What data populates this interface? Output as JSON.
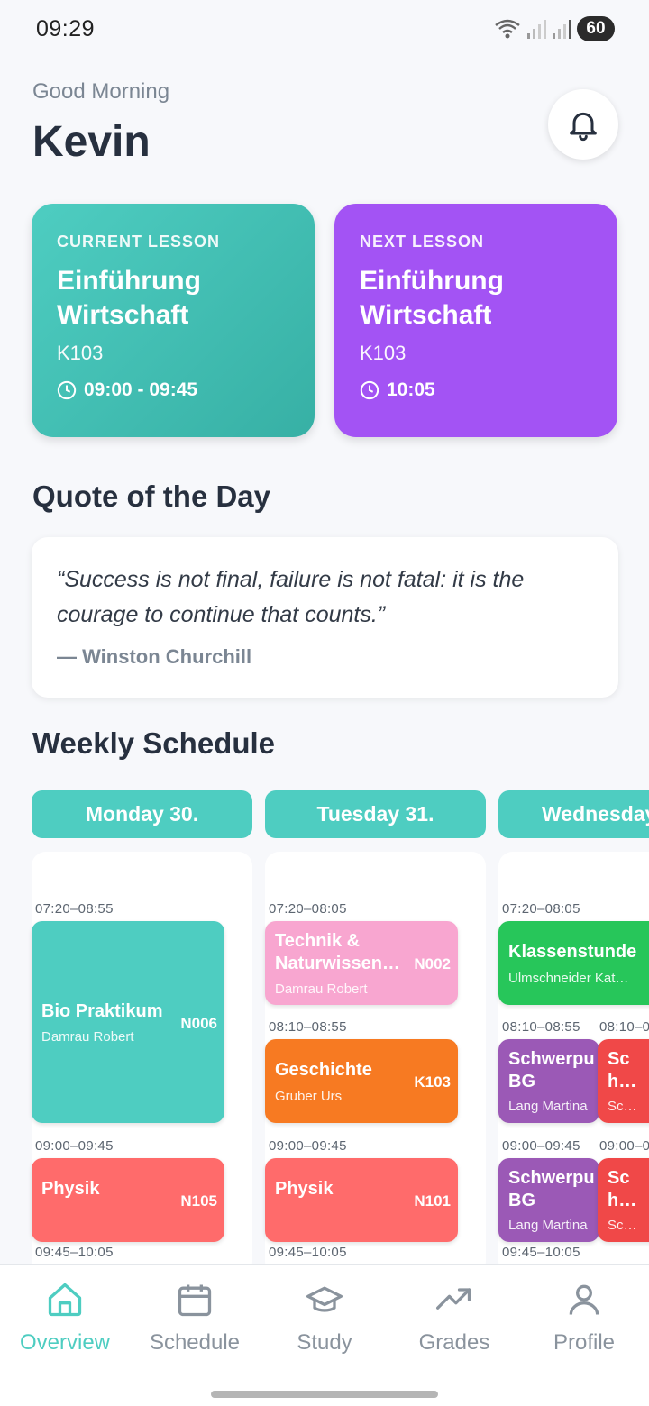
{
  "status_bar": {
    "time": "09:29",
    "battery": "60"
  },
  "header": {
    "greeting": "Good Morning",
    "name": "Kevin"
  },
  "current_lesson": {
    "kicker": "CURRENT LESSON",
    "title": "Einführung Wirtschaft",
    "room": "K103",
    "time": "09:00 - 09:45"
  },
  "next_lesson": {
    "kicker": "NEXT LESSON",
    "title": "Einführung Wirtschaft",
    "room": "K103",
    "time": "10:05"
  },
  "quote": {
    "heading": "Quote of the Day",
    "text": "“Success is not final, failure is not fatal: it is the courage to continue that counts.”",
    "author": "— Winston Churchill"
  },
  "schedule": {
    "heading": "Weekly Schedule",
    "days": [
      {
        "label": "Monday 30.",
        "times": [
          "07:20–08:55",
          "09:00–09:45",
          "09:45–10:05"
        ],
        "lessons": [
          {
            "subject": "Bio Praktikum",
            "teacher": "Damrau Robert",
            "room": "N006"
          },
          {
            "subject": "Physik",
            "teacher": "",
            "room": "N105"
          }
        ]
      },
      {
        "label": "Tuesday 31.",
        "times": [
          "07:20–08:05",
          "08:10–08:55",
          "09:00–09:45",
          "09:45–10:05"
        ],
        "lessons": [
          {
            "subject": "Technik & Naturwissen…",
            "teacher": "Damrau Robert",
            "room": "N002"
          },
          {
            "subject": "Geschichte",
            "teacher": "Gruber Urs",
            "room": "K103"
          },
          {
            "subject": "Physik",
            "teacher": "",
            "room": "N101"
          }
        ]
      },
      {
        "label": "Wednesday",
        "times": [
          "07:20–08:05",
          "08:10–08:55",
          "08:10–0",
          "09:00–09:45",
          "09:00–0",
          "09:45–10:05"
        ],
        "lessons": [
          {
            "subject": "Klassenstunde",
            "teacher": "Ulmschneider Kat…",
            "room": ""
          },
          {
            "subject": "Schwerpu BG",
            "teacher": "Lang Martina",
            "room": ""
          },
          {
            "subject": "Sc h…",
            "teacher": "Sc…",
            "room": ""
          },
          {
            "subject": "Schwerpu BG",
            "teacher": "Lang Martina",
            "room": ""
          },
          {
            "subject": "Sc h…",
            "teacher": "Sc…",
            "room": ""
          }
        ]
      }
    ]
  },
  "nav": [
    {
      "label": "Overview",
      "icon": "home-icon",
      "active": true
    },
    {
      "label": "Schedule",
      "icon": "calendar-icon",
      "active": false
    },
    {
      "label": "Study",
      "icon": "graduation-cap-icon",
      "active": false
    },
    {
      "label": "Grades",
      "icon": "trending-up-icon",
      "active": false
    },
    {
      "label": "Profile",
      "icon": "user-icon",
      "active": false
    }
  ],
  "colors": {
    "teal": "#4ecdc1",
    "purple": "#a353f4",
    "pink": "#f8a6d0",
    "orange": "#f77a22",
    "coral": "#ff6b6b",
    "green": "#27c65a",
    "violet": "#9b59b6",
    "red": "#f04848"
  }
}
